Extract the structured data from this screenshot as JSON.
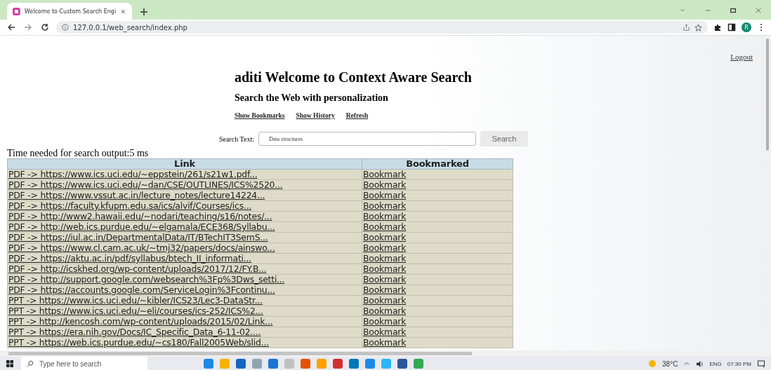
{
  "browser": {
    "tab": {
      "title": "Welcome to Custom Search Engi",
      "selected": true
    },
    "address": "127.0.0.1/web_search/index.php",
    "profile": "R"
  },
  "page": {
    "logout": "Logout",
    "title": "aditi Welcome to Context Aware Search",
    "subtitle": "Search the Web with personalization",
    "links": [
      "Show Bookmarks",
      "Show History",
      "Refresh"
    ],
    "search": {
      "label": "Search Text:",
      "value": "Data structures",
      "button": "Search"
    },
    "timing": "Time needed for search output:5 ms",
    "table": {
      "columns": [
        "Link",
        "Bookmarked"
      ],
      "rows": [
        {
          "link": "PDF -> https://www.ics.uci.edu/~eppstein/261/s21w1.pdf...",
          "action": "Bookmark"
        },
        {
          "link": "PDF -> https://www.ics.uci.edu/~dan/CSE/OUTLINES/ICS%2520...",
          "action": "Bookmark"
        },
        {
          "link": "PDF -> https://www.vssut.ac.in/lecture_notes/lecture14224...",
          "action": "Bookmark"
        },
        {
          "link": "PDF -> https://faculty.kfupm.edu.sa/ics/alvif/Courses/ics...",
          "action": "Bookmark"
        },
        {
          "link": "PDF -> http://www2.hawaii.edu/~nodari/teaching/s16/notes/...",
          "action": "Bookmark"
        },
        {
          "link": "PDF -> http://web.ics.purdue.edu/~elgamala/ECE368/Syllabu...",
          "action": "Bookmark"
        },
        {
          "link": "PDF -> https://iul.ac.in/DepartmentalData/IT/BTechIT3SemS...",
          "action": "Bookmark"
        },
        {
          "link": "PDF -> https://www.cl.cam.ac.uk/~tmj32/papers/docs/ainswo...",
          "action": "Bookmark"
        },
        {
          "link": "PDF -> https://aktu.ac.in/pdf/syllabus/btech_II_informati...",
          "action": "Bookmark"
        },
        {
          "link": "PDF -> http://icskhed.org/wp-content/uploads/2017/12/FY.B...",
          "action": "Bookmark"
        },
        {
          "link": "PDF -> http://support.google.com/websearch%3Fp%3Dws_setti...",
          "action": "Bookmark"
        },
        {
          "link": "PDF -> https://accounts.google.com/ServiceLogin%3Fcontinu...",
          "action": "Bookmark"
        },
        {
          "link": "PPT -> https://www.ics.uci.edu/~kibler/ICS23/Lec3-DataStr...",
          "action": "Bookmark"
        },
        {
          "link": "PPT -> https://www.ics.uci.edu/~eli/courses/ics-252/ICS%2...",
          "action": "Bookmark"
        },
        {
          "link": "PPT -> http://kencosh.com/wp-content/uploads/2015/02/Link...",
          "action": "Bookmark"
        },
        {
          "link": "PPT -> https://era.nih.gov/Docs/IC_Specific_Data_6-11-02....",
          "action": "Bookmark"
        },
        {
          "link": "PPT -> https://web.ics.purdue.edu/~cs180/Fall2005Web/slid...",
          "action": "Bookmark"
        }
      ]
    }
  },
  "taskbar": {
    "search_placeholder": "Type here to search",
    "weather": "38°C",
    "language": "ENG",
    "time": "07:30 PM"
  }
}
